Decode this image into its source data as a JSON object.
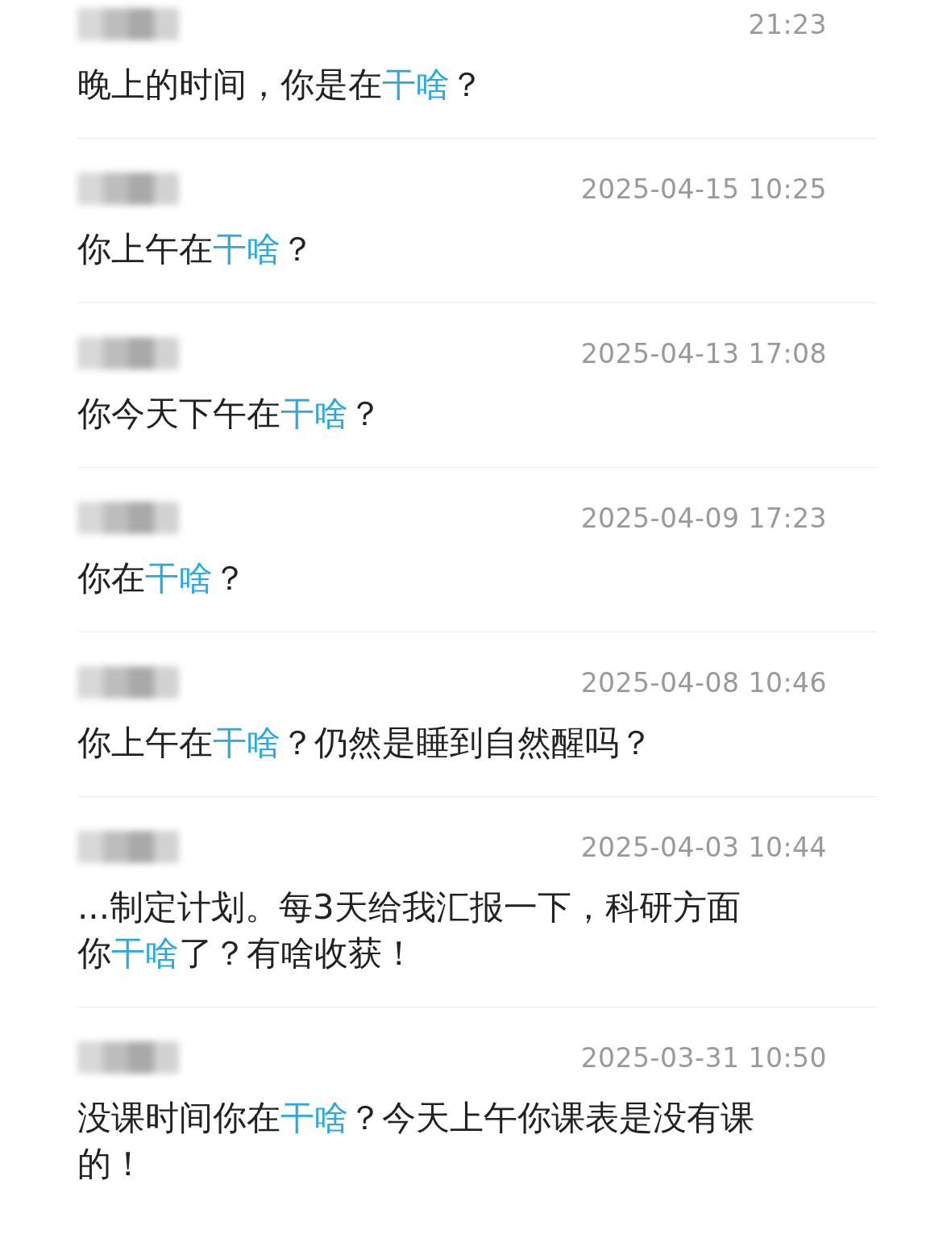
{
  "messages": [
    {
      "time": "21:23",
      "text": [
        {
          "text": "晚上的时间，你是在",
          "highlight": false
        },
        {
          "text": "干啥",
          "highlight": true
        },
        {
          "text": "？",
          "highlight": false
        }
      ]
    },
    {
      "time": "2025-04-15 10:25",
      "text": [
        {
          "text": "你上午在",
          "highlight": false
        },
        {
          "text": "干啥",
          "highlight": true
        },
        {
          "text": "？",
          "highlight": false
        }
      ]
    },
    {
      "time": "2025-04-13 17:08",
      "text": [
        {
          "text": "你今天下午在",
          "highlight": false
        },
        {
          "text": "干啥",
          "highlight": true
        },
        {
          "text": "？",
          "highlight": false
        }
      ]
    },
    {
      "time": "2025-04-09 17:23",
      "text": [
        {
          "text": "你在",
          "highlight": false
        },
        {
          "text": "干啥",
          "highlight": true
        },
        {
          "text": "？",
          "highlight": false
        }
      ]
    },
    {
      "time": "2025-04-08 10:46",
      "text": [
        {
          "text": "你上午在",
          "highlight": false
        },
        {
          "text": "干啥",
          "highlight": true
        },
        {
          "text": "？仍然是睡到自然醒吗？",
          "highlight": false
        }
      ]
    },
    {
      "time": "2025-04-03 10:44",
      "text": [
        {
          "text": "...制定计划。每3天给我汇报一下，科研方面你",
          "highlight": false
        },
        {
          "text": "干啥",
          "highlight": true
        },
        {
          "text": "了？有啥收获！",
          "highlight": false
        }
      ]
    },
    {
      "time": "2025-03-31 10:50",
      "text": [
        {
          "text": "没课时间你在",
          "highlight": false
        },
        {
          "text": "干啥",
          "highlight": true
        },
        {
          "text": "？今天上午你课表是没有课的！",
          "highlight": false
        }
      ]
    }
  ]
}
